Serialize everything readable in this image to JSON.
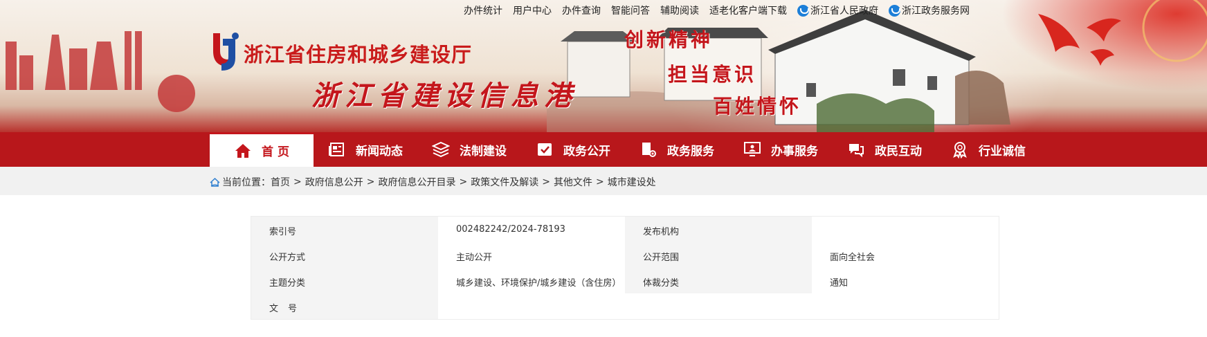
{
  "header": {
    "top_links": [
      "办件统计",
      "用户中心",
      "办件查询",
      "智能问答",
      "辅助阅读",
      "适老化客户端下载"
    ],
    "gov_links": [
      {
        "label": "浙江省人民政府",
        "icon": "zhejiang-gov-icon"
      },
      {
        "label": "浙江政务服务网",
        "icon": "zjzwfw-icon"
      }
    ],
    "org_name": "浙江省住房和城乡建设厅",
    "site_name": "浙江省建设信息港",
    "slogans": [
      "创新精神",
      "担当意识",
      "百姓情怀"
    ]
  },
  "nav": {
    "items": [
      {
        "label": "首 页",
        "icon": "home-icon",
        "active": true
      },
      {
        "label": "新闻动态",
        "icon": "newspaper-icon"
      },
      {
        "label": "法制建设",
        "icon": "layers-icon"
      },
      {
        "label": "政务公开",
        "icon": "check-board-icon"
      },
      {
        "label": "政务服务",
        "icon": "service-gear-icon"
      },
      {
        "label": "办事服务",
        "icon": "monitor-person-icon"
      },
      {
        "label": "政民互动",
        "icon": "chat-icon"
      },
      {
        "label": "行业诚信",
        "icon": "badge-icon"
      }
    ],
    "colors": {
      "bar": "#b8171b",
      "active_text": "#c4161c"
    }
  },
  "breadcrumb": {
    "prefix": "当前位置：",
    "items": [
      "首页",
      "政府信息公开",
      "政府信息公开目录",
      "政策文件及解读",
      "其他文件",
      "城市建设处"
    ],
    "separator": ">"
  },
  "info": {
    "index_label": "索引号",
    "index_value": "002482242/2024-78193",
    "publisher_label": "发布机构",
    "publisher_value": "",
    "method_label": "公开方式",
    "method_value": "主动公开",
    "scope_label": "公开范围",
    "scope_value": "面向全社会",
    "topic_label": "主题分类",
    "topic_value": "城乡建设、环境保护/城乡建设（含住房）",
    "genre_label": "体裁分类",
    "genre_value": "通知",
    "docno_label": "文号",
    "docno_value": ""
  }
}
